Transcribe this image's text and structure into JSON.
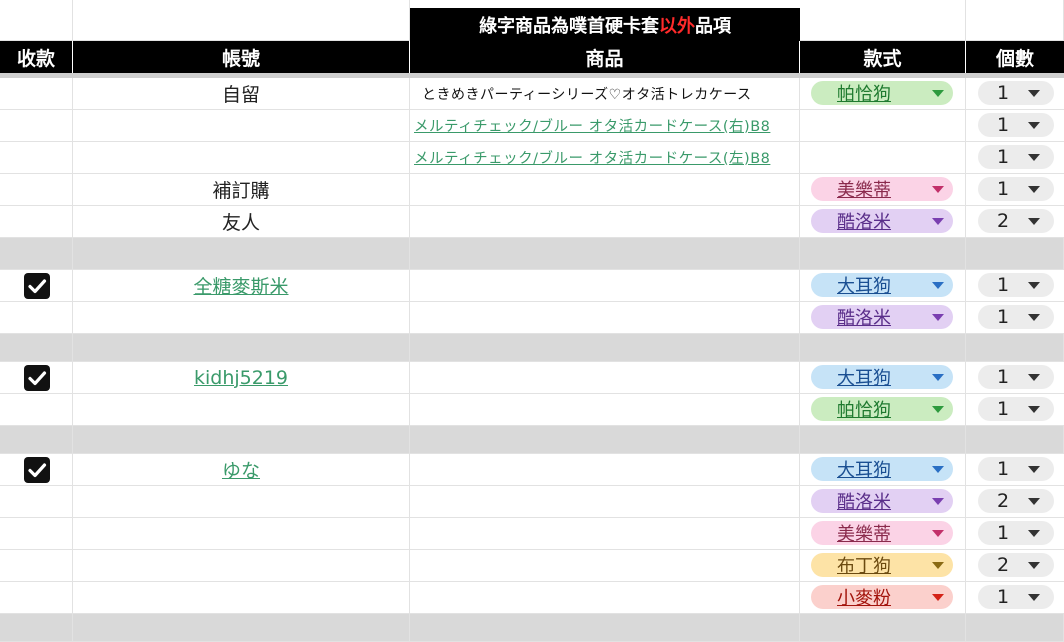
{
  "banner": {
    "prefix": "綠字商品為噗首硬卡套",
    "highlight": "以外",
    "suffix": "品項"
  },
  "headers": {
    "paid": "收款",
    "account": "帳號",
    "product": "商品",
    "style": "款式",
    "qty": "個數"
  },
  "colors": {
    "chip_green": "#cbecc0",
    "chip_pink": "#fbd3e6",
    "chip_purple": "#e2d0f3",
    "chip_blue": "#c6e3f7",
    "chip_yellow": "#fde3a6",
    "chip_red": "#fbd0cc"
  },
  "rows": [
    {
      "account": "自留",
      "product": "ときめきパーティーシリーズ♡オタ活トレカケース",
      "style": "帕恰狗",
      "qty": "1"
    },
    {
      "product": "メルティチェック/ブルー オタ活カードケース(右)B8",
      "qty": "1"
    },
    {
      "product": "メルティチェック/ブルー オタ活カードケース(左)B8",
      "qty": "1"
    },
    {
      "account": "補訂購",
      "style": "美樂蒂",
      "qty": "1"
    },
    {
      "account": "友人",
      "style": "酷洛米",
      "qty": "2"
    },
    {
      "account": "全糖麥斯米",
      "style": "大耳狗",
      "qty": "1",
      "paid": true
    },
    {
      "style": "酷洛米",
      "qty": "1"
    },
    {
      "account": "kidhj5219",
      "style": "大耳狗",
      "qty": "1",
      "paid": true
    },
    {
      "style": "帕恰狗",
      "qty": "1"
    },
    {
      "account": "ゆな",
      "style": "大耳狗",
      "qty": "1",
      "paid": true
    },
    {
      "style": "酷洛米",
      "qty": "2"
    },
    {
      "style": "美樂蒂",
      "qty": "1"
    },
    {
      "style": "布丁狗",
      "qty": "2"
    },
    {
      "style": "小麥粉",
      "qty": "1"
    }
  ]
}
